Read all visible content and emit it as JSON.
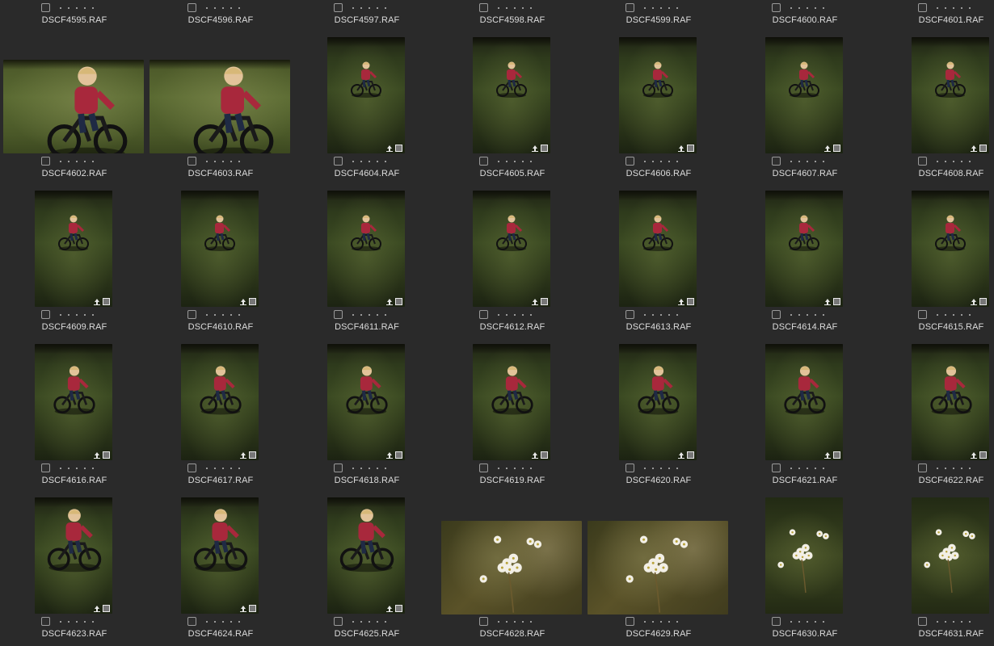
{
  "grid": {
    "columns": 7,
    "rows": [
      {
        "items": [
          {
            "filename": "DSCF4595.RAF",
            "type": "none"
          },
          {
            "filename": "DSCF4596.RAF",
            "type": "none"
          },
          {
            "filename": "DSCF4597.RAF",
            "type": "none"
          },
          {
            "filename": "DSCF4598.RAF",
            "type": "none"
          },
          {
            "filename": "DSCF4599.RAF",
            "type": "none"
          },
          {
            "filename": "DSCF4600.RAF",
            "type": "none"
          },
          {
            "filename": "DSCF4601.RAF",
            "type": "none"
          }
        ]
      },
      {
        "items": [
          {
            "filename": "DSCF4602.RAF",
            "type": "landscape",
            "scene": "kid-close",
            "badges": false
          },
          {
            "filename": "DSCF4603.RAF",
            "type": "landscape",
            "scene": "kid-close",
            "badges": false
          },
          {
            "filename": "DSCF4604.RAF",
            "type": "portrait",
            "scene": "kid-far",
            "badges": true
          },
          {
            "filename": "DSCF4605.RAF",
            "type": "portrait",
            "scene": "kid-far",
            "badges": true
          },
          {
            "filename": "DSCF4606.RAF",
            "type": "portrait",
            "scene": "kid-far",
            "badges": true
          },
          {
            "filename": "DSCF4607.RAF",
            "type": "portrait",
            "scene": "kid-far",
            "badges": true
          },
          {
            "filename": "DSCF4608.RAF",
            "type": "portrait",
            "scene": "kid-far",
            "badges": true
          }
        ]
      },
      {
        "items": [
          {
            "filename": "DSCF4609.RAF",
            "type": "portrait",
            "scene": "kid-far",
            "badges": true
          },
          {
            "filename": "DSCF4610.RAF",
            "type": "portrait",
            "scene": "kid-far",
            "badges": true
          },
          {
            "filename": "DSCF4611.RAF",
            "type": "portrait",
            "scene": "kid-far",
            "badges": true
          },
          {
            "filename": "DSCF4612.RAF",
            "type": "portrait",
            "scene": "kid-far",
            "badges": true
          },
          {
            "filename": "DSCF4613.RAF",
            "type": "portrait",
            "scene": "kid-far",
            "badges": true
          },
          {
            "filename": "DSCF4614.RAF",
            "type": "portrait",
            "scene": "kid-far",
            "badges": true
          },
          {
            "filename": "DSCF4615.RAF",
            "type": "portrait",
            "scene": "kid-far",
            "badges": true
          }
        ]
      },
      {
        "items": [
          {
            "filename": "DSCF4616.RAF",
            "type": "portrait",
            "scene": "kid-mid",
            "badges": true
          },
          {
            "filename": "DSCF4617.RAF",
            "type": "portrait",
            "scene": "kid-mid",
            "badges": true
          },
          {
            "filename": "DSCF4618.RAF",
            "type": "portrait",
            "scene": "kid-mid",
            "badges": true
          },
          {
            "filename": "DSCF4619.RAF",
            "type": "portrait",
            "scene": "kid-mid",
            "badges": true
          },
          {
            "filename": "DSCF4620.RAF",
            "type": "portrait",
            "scene": "kid-mid",
            "badges": true
          },
          {
            "filename": "DSCF4621.RAF",
            "type": "portrait",
            "scene": "kid-mid",
            "badges": true
          },
          {
            "filename": "DSCF4622.RAF",
            "type": "portrait",
            "scene": "kid-mid",
            "badges": true
          }
        ]
      },
      {
        "items": [
          {
            "filename": "DSCF4623.RAF",
            "type": "portrait",
            "scene": "kid-near",
            "badges": true
          },
          {
            "filename": "DSCF4624.RAF",
            "type": "portrait",
            "scene": "kid-near",
            "badges": true
          },
          {
            "filename": "DSCF4625.RAF",
            "type": "portrait",
            "scene": "kid-near",
            "badges": true
          },
          {
            "filename": "DSCF4628.RAF",
            "type": "landscape",
            "scene": "flower",
            "badges": false
          },
          {
            "filename": "DSCF4629.RAF",
            "type": "landscape",
            "scene": "flower",
            "badges": false
          },
          {
            "filename": "DSCF4630.RAF",
            "type": "portrait",
            "scene": "flower-dark",
            "badges": false
          },
          {
            "filename": "DSCF4631.RAF",
            "type": "portrait",
            "scene": "flower-dark",
            "badges": false
          }
        ]
      }
    ]
  },
  "colors": {
    "background": "#2a2a2a",
    "label": "#dcdcdc",
    "jacket": "#a8283c"
  },
  "icons": {
    "upload_badge": "upload-arrow-icon",
    "edit_badge": "sidecar-file-icon"
  }
}
